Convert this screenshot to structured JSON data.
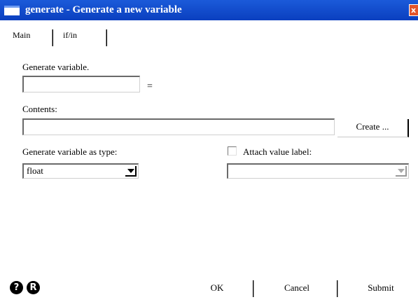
{
  "window": {
    "title": "generate - Generate a new variable",
    "close_glyph": "x"
  },
  "tabs": [
    {
      "label": "Main",
      "active": true
    },
    {
      "label": "if/in",
      "active": false
    }
  ],
  "form": {
    "generate_variable_label": "Generate variable.",
    "variable_value": "",
    "equals": "=",
    "contents_label": "Contents:",
    "contents_value": "",
    "create_button": "Create ...",
    "type_label": "Generate variable as type:",
    "type_value": "float",
    "attach_label": "Attach value label:",
    "attach_checked": false,
    "value_label_value": ""
  },
  "footer": {
    "help_icon": "?",
    "reset_icon": "R",
    "ok": "OK",
    "cancel": "Cancel",
    "submit": "Submit"
  },
  "colors": {
    "titlebar": "#0a3fbf",
    "close": "#e3542a"
  }
}
